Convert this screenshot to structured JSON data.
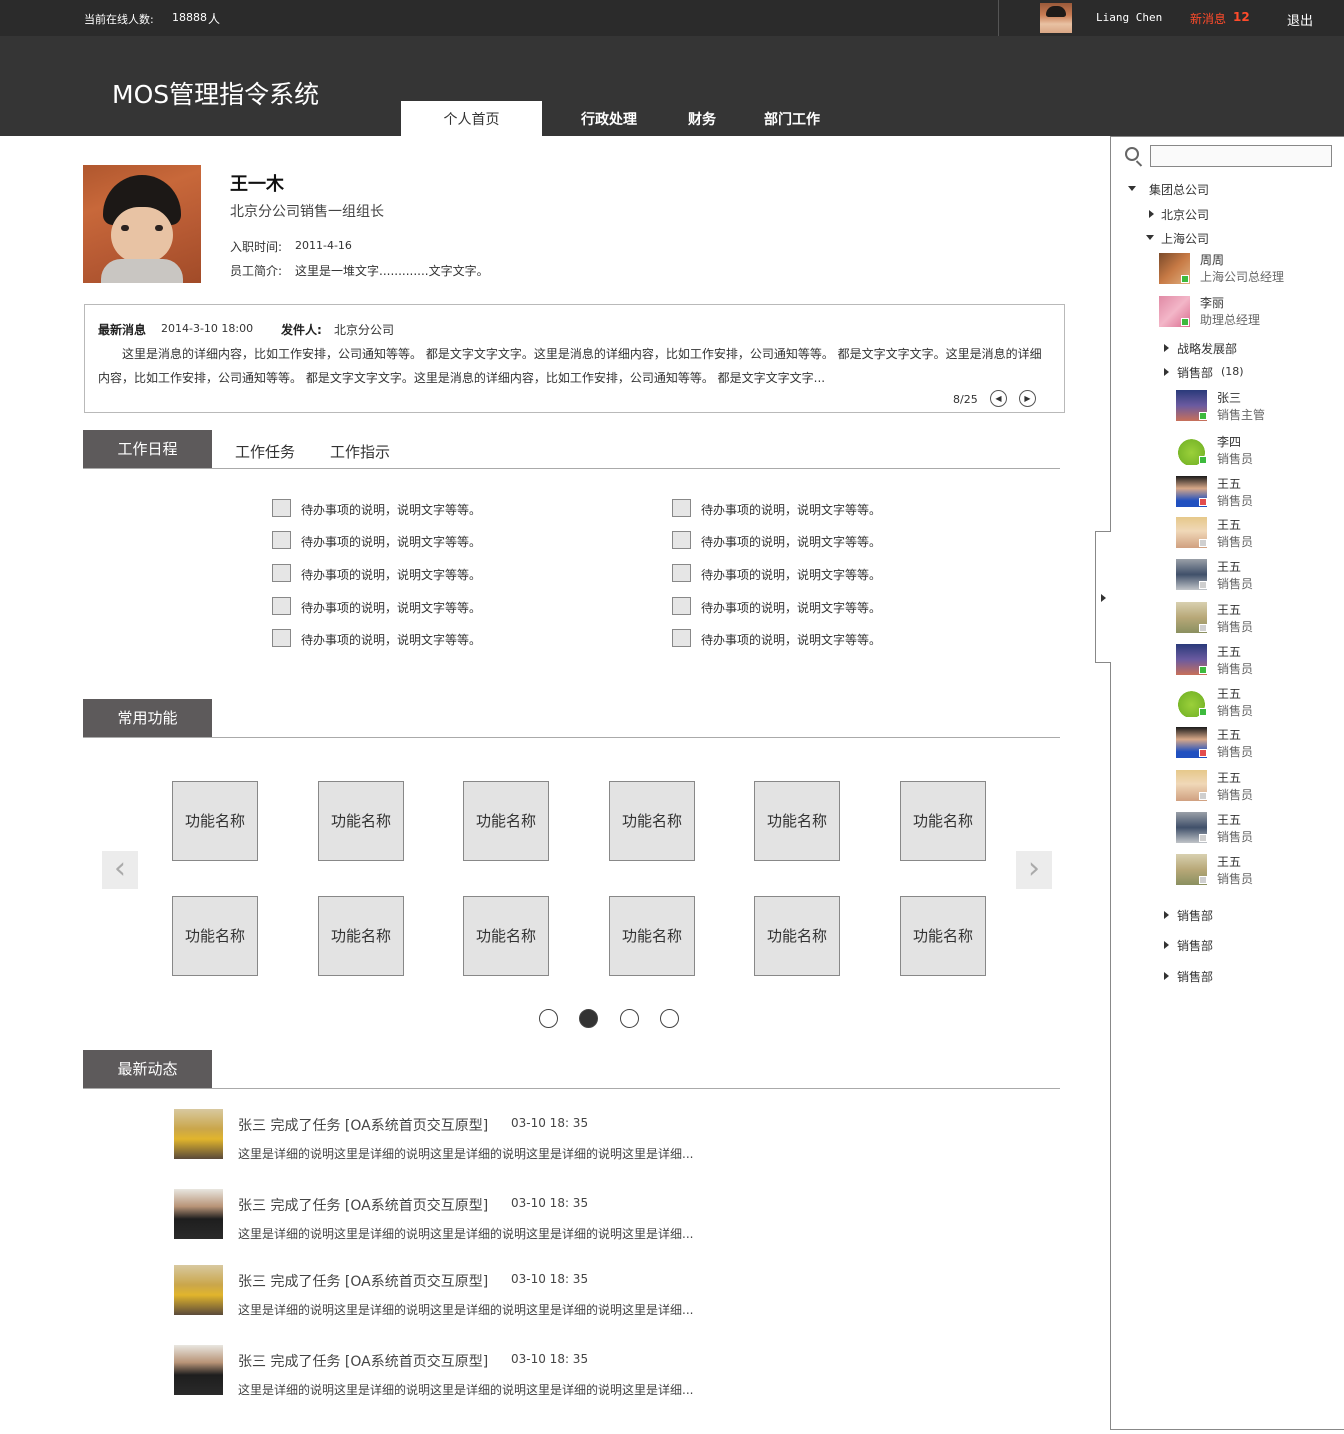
{
  "topbar": {
    "online_label": "当前在线人数:",
    "online_count": "18888",
    "online_unit": "人",
    "user_name": "Liang Chen",
    "new_msg_label": "新消息",
    "new_msg_count": "12",
    "logout": "退出"
  },
  "header": {
    "app_title": "MOS管理指令系统",
    "nav": [
      "个人首页",
      "行政处理",
      "财务",
      "部门工作"
    ]
  },
  "profile": {
    "name": "王一木",
    "title": "北京分公司销售一组组长",
    "join_label": "入职时间:",
    "join_date": "2011-4-16",
    "intro_label": "员工简介:",
    "intro_text": "这里是一堆文字.............文字文字。"
  },
  "message": {
    "label": "最新消息",
    "date": "2014-3-10 18:00",
    "sender_label": "发件人:",
    "sender": "北京分公司",
    "line1": "这里是消息的详细内容，比如工作安排，公司通知等等。 都是文字文字文字。这里是消息的详细内容，比如工作安排，公司通知等等。 都是文字文字文字。这里是消息的详细",
    "line2": "内容，比如工作安排，公司通知等等。 都是文字文字文字。这里是消息的详细内容，比如工作安排，公司通知等等。 都是文字文字文字...",
    "pager": "8/25"
  },
  "schedule": {
    "tabs": [
      "工作日程",
      "工作任务",
      "工作指示"
    ],
    "todo_text": "待办事项的说明，说明文字等等。"
  },
  "functions": {
    "section_title": "常用功能",
    "tile_label": "功能名称",
    "page_count": 4,
    "current_page": 2
  },
  "feed": {
    "section_title": "最新动态",
    "items": [
      {
        "title": "张三 完成了任务 [OA系统首页交互原型]",
        "time": "03-10 18: 35",
        "body": "这里是详细的说明这里是详细的说明这里是详细的说明这里是详细的说明这里是详细..."
      },
      {
        "title": "张三 完成了任务 [OA系统首页交互原型]",
        "time": "03-10 18: 35",
        "body": "这里是详细的说明这里是详细的说明这里是详细的说明这里是详细的说明这里是详细..."
      },
      {
        "title": "张三 完成了任务 [OA系统首页交互原型]",
        "time": "03-10 18: 35",
        "body": "这里是详细的说明这里是详细的说明这里是详细的说明这里是详细的说明这里是详细..."
      },
      {
        "title": "张三 完成了任务 [OA系统首页交互原型]",
        "time": "03-10 18: 35",
        "body": "这里是详细的说明这里是详细的说明这里是详细的说明这里是详细的说明这里是详细..."
      }
    ]
  },
  "org": {
    "root": "集团总公司",
    "beijing": "北京公司",
    "shanghai": "上海公司",
    "shanghai_people": [
      {
        "name": "周周",
        "role": "上海公司总经理",
        "status": "online"
      },
      {
        "name": "李丽",
        "role": "助理总经理",
        "status": "online"
      }
    ],
    "strategy": "战略发展部",
    "sales": "销售部",
    "sales_count": "(18)",
    "sales_people": [
      {
        "name": "张三",
        "role": "销售主管",
        "status": "online"
      },
      {
        "name": "李四",
        "role": "销售员",
        "status": "online"
      },
      {
        "name": "王五",
        "role": "销售员",
        "status": "busy"
      },
      {
        "name": "王五",
        "role": "销售员",
        "status": "offline"
      },
      {
        "name": "王五",
        "role": "销售员",
        "status": "offline"
      },
      {
        "name": "王五",
        "role": "销售员",
        "status": "offline"
      },
      {
        "name": "王五",
        "role": "销售员",
        "status": "online"
      },
      {
        "name": "王五",
        "role": "销售员",
        "status": "online"
      },
      {
        "name": "王五",
        "role": "销售员",
        "status": "busy"
      },
      {
        "name": "王五",
        "role": "销售员",
        "status": "offline"
      },
      {
        "name": "王五",
        "role": "销售员",
        "status": "offline"
      },
      {
        "name": "王五",
        "role": "销售员",
        "status": "offline"
      }
    ],
    "more_depts": [
      "销售部",
      "销售部",
      "销售部"
    ]
  },
  "colors": {
    "dark_bar": "#2b2b2b",
    "header": "#353535",
    "accent_red": "#ff4b2b",
    "tab_bg": "#5d5a5b"
  }
}
